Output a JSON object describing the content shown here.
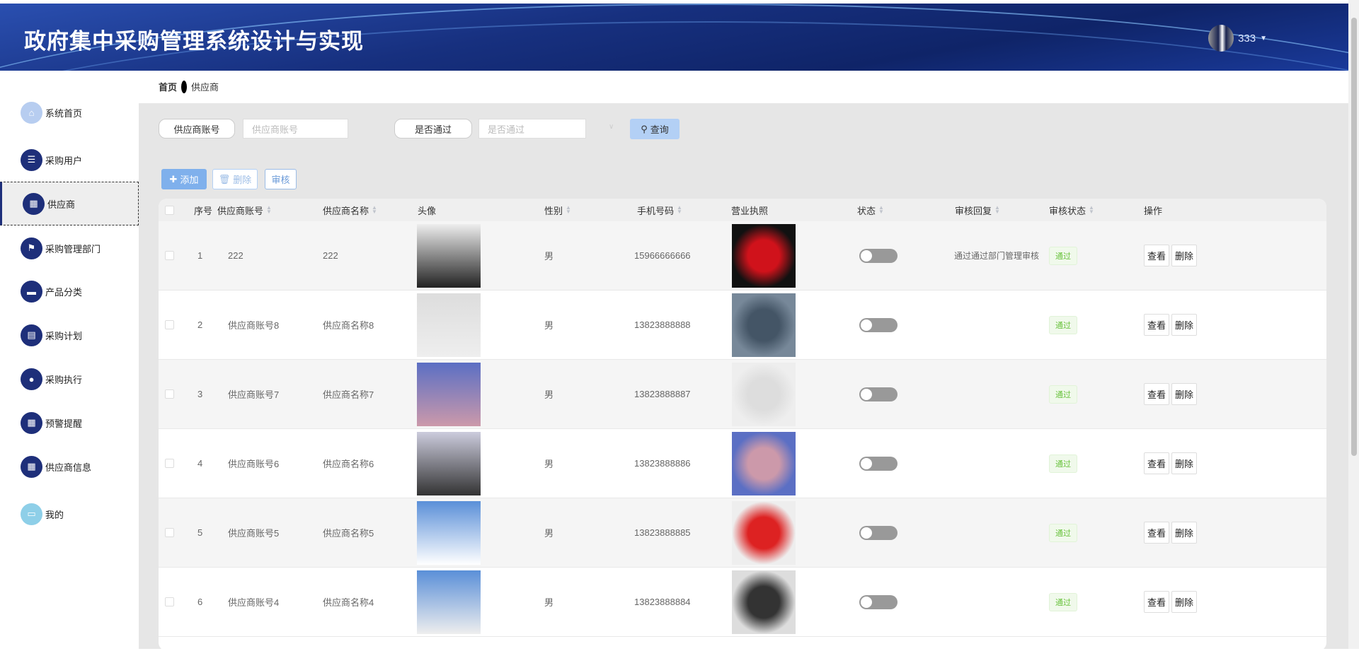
{
  "header": {
    "title": "政府集中采购管理系统设计与实现",
    "username": "333"
  },
  "breadcrumb": {
    "home": "首页",
    "current": "供应商"
  },
  "sidebar": {
    "items": [
      {
        "label": "系统首页",
        "icon": "home-icon"
      },
      {
        "label": "采购用户",
        "icon": "list-icon"
      },
      {
        "label": "供应商",
        "icon": "grid-icon"
      },
      {
        "label": "采购管理部门",
        "icon": "flag-icon"
      },
      {
        "label": "产品分类",
        "icon": "monitor-icon"
      },
      {
        "label": "采购计划",
        "icon": "clipboard-icon"
      },
      {
        "label": "采购执行",
        "icon": "bulb-icon"
      },
      {
        "label": "预警提醒",
        "icon": "grid-icon"
      },
      {
        "label": "供应商信息",
        "icon": "grid-icon"
      },
      {
        "label": "我的",
        "icon": "card-icon"
      }
    ]
  },
  "search": {
    "account_label": "供应商账号",
    "account_placeholder": "供应商账号",
    "pass_label": "是否通过",
    "pass_placeholder": "是否通过",
    "query_label": "查询"
  },
  "toolbar": {
    "add": "添加",
    "delete": "删除",
    "audit": "审核"
  },
  "table": {
    "columns": [
      "序号",
      "供应商账号",
      "供应商名称",
      "头像",
      "性别",
      "手机号码",
      "营业执照",
      "状态",
      "审核回复",
      "审核状态",
      "操作"
    ],
    "view_label": "查看",
    "delete_label": "删除",
    "rows": [
      {
        "no": "1",
        "account": "222",
        "name": "222",
        "gender": "男",
        "phone": "15966666666",
        "reply": "通过通过部门管理审核",
        "status": "通过"
      },
      {
        "no": "2",
        "account": "供应商账号8",
        "name": "供应商名称8",
        "gender": "男",
        "phone": "13823888888",
        "reply": "",
        "status": "通过"
      },
      {
        "no": "3",
        "account": "供应商账号7",
        "name": "供应商名称7",
        "gender": "男",
        "phone": "13823888887",
        "reply": "",
        "status": "通过"
      },
      {
        "no": "4",
        "account": "供应商账号6",
        "name": "供应商名称6",
        "gender": "男",
        "phone": "13823888886",
        "reply": "",
        "status": "通过"
      },
      {
        "no": "5",
        "account": "供应商账号5",
        "name": "供应商名称5",
        "gender": "男",
        "phone": "13823888885",
        "reply": "",
        "status": "通过"
      },
      {
        "no": "6",
        "account": "供应商账号4",
        "name": "供应商名称4",
        "gender": "男",
        "phone": "13823888884",
        "reply": "",
        "status": "通过"
      }
    ]
  },
  "colors": {
    "primary": "#1e2f7a",
    "query_bg": "#b3d0f5",
    "pass": "#67c23a"
  }
}
